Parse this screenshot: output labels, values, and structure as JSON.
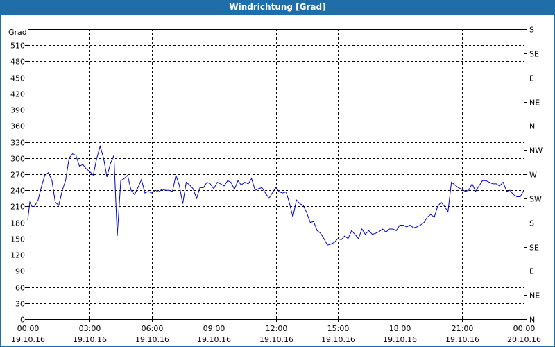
{
  "window": {
    "title": "Windrichtung [Grad]"
  },
  "chart_data": {
    "type": "line",
    "title": "Windrichtung [Grad]",
    "ylabel": "Grad",
    "ylim": [
      0,
      540
    ],
    "yticks": [
      0,
      30,
      60,
      90,
      120,
      150,
      180,
      210,
      240,
      270,
      300,
      330,
      360,
      390,
      420,
      450,
      480,
      510
    ],
    "y2_ticks": [
      {
        "value": 0,
        "label": "N"
      },
      {
        "value": 45,
        "label": "NE"
      },
      {
        "value": 90,
        "label": "E"
      },
      {
        "value": 135,
        "label": "SE"
      },
      {
        "value": 180,
        "label": "S"
      },
      {
        "value": 225,
        "label": "SW"
      },
      {
        "value": 270,
        "label": "W"
      },
      {
        "value": 315,
        "label": "NW"
      },
      {
        "value": 360,
        "label": "N"
      },
      {
        "value": 405,
        "label": "NE"
      },
      {
        "value": 450,
        "label": "E"
      },
      {
        "value": 495,
        "label": "SE"
      },
      {
        "value": 540,
        "label": "S"
      }
    ],
    "xlim": [
      0,
      24
    ],
    "xticks": [
      {
        "hour": 0,
        "time": "00:00",
        "date": "19.10.16"
      },
      {
        "hour": 3,
        "time": "03:00",
        "date": "19.10.16"
      },
      {
        "hour": 6,
        "time": "06:00",
        "date": "19.10.16"
      },
      {
        "hour": 9,
        "time": "09:00",
        "date": "19.10.16"
      },
      {
        "hour": 12,
        "time": "12:00",
        "date": "19.10.16"
      },
      {
        "hour": 15,
        "time": "15:00",
        "date": "19.10.16"
      },
      {
        "hour": 18,
        "time": "18:00",
        "date": "19.10.16"
      },
      {
        "hour": 21,
        "time": "21:00",
        "date": "19.10.16"
      },
      {
        "hour": 24,
        "time": "00:00",
        "date": "20.10.16"
      }
    ],
    "grid": true,
    "line_color": "#0000cc",
    "series": [
      {
        "x": [
          0.0,
          0.1,
          0.2,
          0.33,
          0.5,
          0.67,
          0.83,
          1.0,
          1.17,
          1.33,
          1.5,
          1.67,
          1.83,
          2.0,
          2.17,
          2.33,
          2.5,
          2.67,
          2.83,
          3.0,
          3.17,
          3.33,
          3.5,
          3.67,
          3.83,
          4.0,
          4.17,
          4.33,
          4.5,
          4.67,
          4.83,
          5.0,
          5.17,
          5.33,
          5.5,
          5.67,
          5.83,
          6.0,
          6.17,
          6.33,
          6.5,
          6.67,
          6.83,
          7.0,
          7.17,
          7.33,
          7.5,
          7.67,
          7.83,
          8.0,
          8.17,
          8.33,
          8.5,
          8.67,
          8.83,
          9.0,
          9.17,
          9.33,
          9.5,
          9.67,
          9.83,
          10.0,
          10.17,
          10.33,
          10.5,
          10.67,
          10.83,
          11.0,
          11.17,
          11.33,
          11.5,
          11.67,
          11.83,
          12.0,
          12.17,
          12.33,
          12.5,
          12.67,
          12.83,
          13.0,
          13.17,
          13.33,
          13.5,
          13.67,
          13.83,
          14.0,
          14.17,
          14.33,
          14.5,
          14.67,
          14.83,
          15.0,
          15.17,
          15.33,
          15.5,
          15.67,
          15.83,
          16.0,
          16.17,
          16.33,
          16.5,
          16.67,
          16.83,
          17.0,
          17.17,
          17.33,
          17.5,
          17.67,
          17.83,
          18.0,
          18.17,
          18.33,
          18.5,
          18.67,
          18.83,
          19.0,
          19.17,
          19.33,
          19.5,
          19.67,
          19.83,
          20.0,
          20.17,
          20.33,
          20.5,
          20.67,
          20.83,
          21.0,
          21.17,
          21.33,
          21.5,
          21.67,
          21.83,
          22.0,
          22.17,
          22.33,
          22.5,
          22.67,
          22.83,
          23.0,
          23.17,
          23.33,
          23.5,
          23.67,
          23.83,
          24.0
        ],
        "y": [
          185,
          218,
          210,
          210,
          222,
          248,
          268,
          273,
          258,
          218,
          212,
          240,
          258,
          300,
          308,
          305,
          285,
          288,
          280,
          275,
          268,
          298,
          322,
          300,
          265,
          290,
          305,
          155,
          258,
          262,
          268,
          240,
          232,
          245,
          260,
          235,
          238,
          235,
          240,
          237,
          242,
          240,
          240,
          238,
          268,
          250,
          215,
          255,
          250,
          243,
          225,
          245,
          245,
          255,
          252,
          243,
          255,
          252,
          248,
          258,
          255,
          242,
          258,
          250,
          255,
          252,
          262,
          240,
          243,
          245,
          235,
          225,
          235,
          245,
          237,
          235,
          237,
          215,
          190,
          222,
          215,
          212,
          198,
          180,
          182,
          165,
          160,
          150,
          138,
          140,
          143,
          150,
          148,
          155,
          150,
          165,
          158,
          150,
          168,
          158,
          165,
          158,
          160,
          163,
          168,
          162,
          168,
          168,
          165,
          175,
          175,
          172,
          175,
          170,
          172,
          175,
          180,
          190,
          195,
          190,
          210,
          218,
          210,
          200,
          255,
          250,
          245,
          242,
          238,
          240,
          252,
          238,
          248,
          258,
          258,
          255,
          252,
          252,
          248,
          255,
          238,
          240,
          232,
          228,
          228,
          240
        ]
      }
    ]
  }
}
